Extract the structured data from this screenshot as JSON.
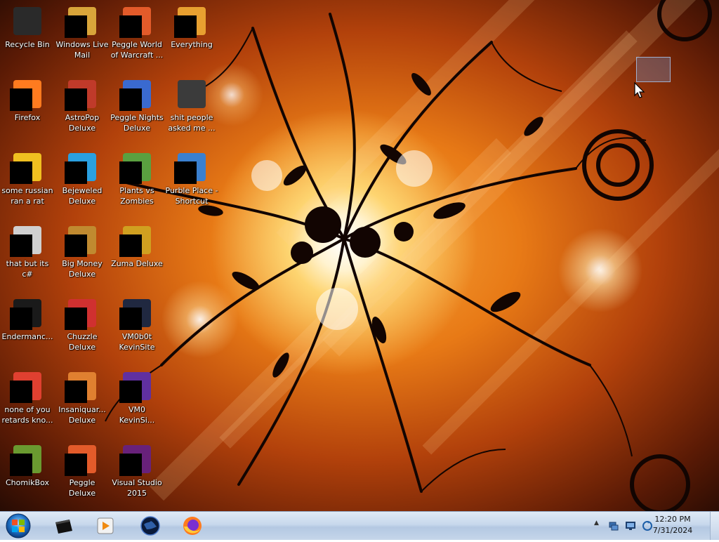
{
  "desktop": {
    "icons": [
      {
        "label": "Recycle Bin",
        "icon": "recycle-bin-icon",
        "censored": false,
        "color": "#2a2a2a"
      },
      {
        "label": "Windows Live\nMail",
        "icon": "mail-icon",
        "censored": true,
        "color": "#d8a53a"
      },
      {
        "label": "Peggle World\nof Warcraft ...",
        "icon": "peggle-icon",
        "censored": true,
        "color": "#e35b2a"
      },
      {
        "label": "Everything",
        "icon": "search-app-icon",
        "censored": true,
        "color": "#e8a030"
      },
      {
        "label": "Firefox",
        "icon": "firefox-icon",
        "censored": true,
        "color": "#ff7b1f"
      },
      {
        "label": "AstroPop\nDeluxe",
        "icon": "astropop-icon",
        "censored": true,
        "color": "#c03a2a"
      },
      {
        "label": "Peggle Nights\nDeluxe",
        "icon": "peggle-nights-icon",
        "censored": true,
        "color": "#3a6ad0"
      },
      {
        "label": "shit people\nasked me ...",
        "icon": "folder-icon",
        "censored": false,
        "color": "#3b3b3b"
      },
      {
        "label": "some russian\nran a rat",
        "icon": "document-icon",
        "censored": true,
        "color": "#f0c020"
      },
      {
        "label": "Bejeweled\nDeluxe",
        "icon": "bejeweled-icon",
        "censored": true,
        "color": "#2aa0e0"
      },
      {
        "label": "Plants vs\nZombies",
        "icon": "plants-vs-zombies-icon",
        "censored": true,
        "color": "#5aa040"
      },
      {
        "label": "Purble Place -\nShortcut",
        "icon": "purble-place-icon",
        "censored": true,
        "color": "#3a80d0"
      },
      {
        "label": "that but its c#",
        "icon": "stack-icon",
        "censored": true,
        "color": "#d0d0d0"
      },
      {
        "label": "Big Money\nDeluxe",
        "icon": "big-money-icon",
        "censored": true,
        "color": "#c08a30"
      },
      {
        "label": "Zuma Deluxe",
        "icon": "zuma-icon",
        "censored": true,
        "color": "#d0a020"
      },
      {
        "label": "",
        "icon": "none",
        "censored": false,
        "color": ""
      },
      {
        "label": "Endermanc...",
        "icon": "terminal-icon",
        "censored": true,
        "color": "#1a1a1a"
      },
      {
        "label": "Chuzzle\nDeluxe",
        "icon": "chuzzle-icon",
        "censored": true,
        "color": "#d03030"
      },
      {
        "label": "VM0b0t\nKevinSite",
        "icon": "vm-icon",
        "censored": true,
        "color": "#202840"
      },
      {
        "label": "",
        "icon": "none",
        "censored": false,
        "color": ""
      },
      {
        "label": "none of you\nretards kno...",
        "icon": "chrome-icon",
        "censored": true,
        "color": "#e04030"
      },
      {
        "label": "Insaniquar...\nDeluxe",
        "icon": "insaniquarium-icon",
        "censored": true,
        "color": "#e08030"
      },
      {
        "label": "VM0\nKevinSi...",
        "icon": "vm-icon",
        "censored": true,
        "color": "#6030a0"
      },
      {
        "label": "",
        "icon": "none",
        "censored": false,
        "color": ""
      },
      {
        "label": "ChomikBox",
        "icon": "chomikbox-icon",
        "censored": true,
        "color": "#6a9a30"
      },
      {
        "label": "Peggle Deluxe",
        "icon": "peggle-icon",
        "censored": true,
        "color": "#e35b2a"
      },
      {
        "label": "Visual Studio\n2015",
        "icon": "visual-studio-icon",
        "censored": true,
        "color": "#68217a"
      }
    ]
  },
  "taskbar": {
    "start_label": "Start",
    "pinned": [
      {
        "name": "taskbar-terminal",
        "icon": "terminal-icon"
      },
      {
        "name": "taskbar-media-player",
        "icon": "media-player-icon"
      },
      {
        "name": "taskbar-globe-browser",
        "icon": "globe-icon"
      },
      {
        "name": "taskbar-firefox",
        "icon": "firefox-icon"
      }
    ],
    "tray": {
      "show_hidden_label": "▲",
      "icons": [
        "network-icon",
        "monitor-icon",
        "sync-icon"
      ]
    },
    "clock": {
      "time": "12:20 PM",
      "date": "7/31/2024"
    }
  },
  "colors": {
    "taskbar_top": "#dfeaf6",
    "taskbar_bottom": "#c5d6ea",
    "wallpaper_center": "#f7a43a",
    "wallpaper_edge": "#1c0803"
  }
}
